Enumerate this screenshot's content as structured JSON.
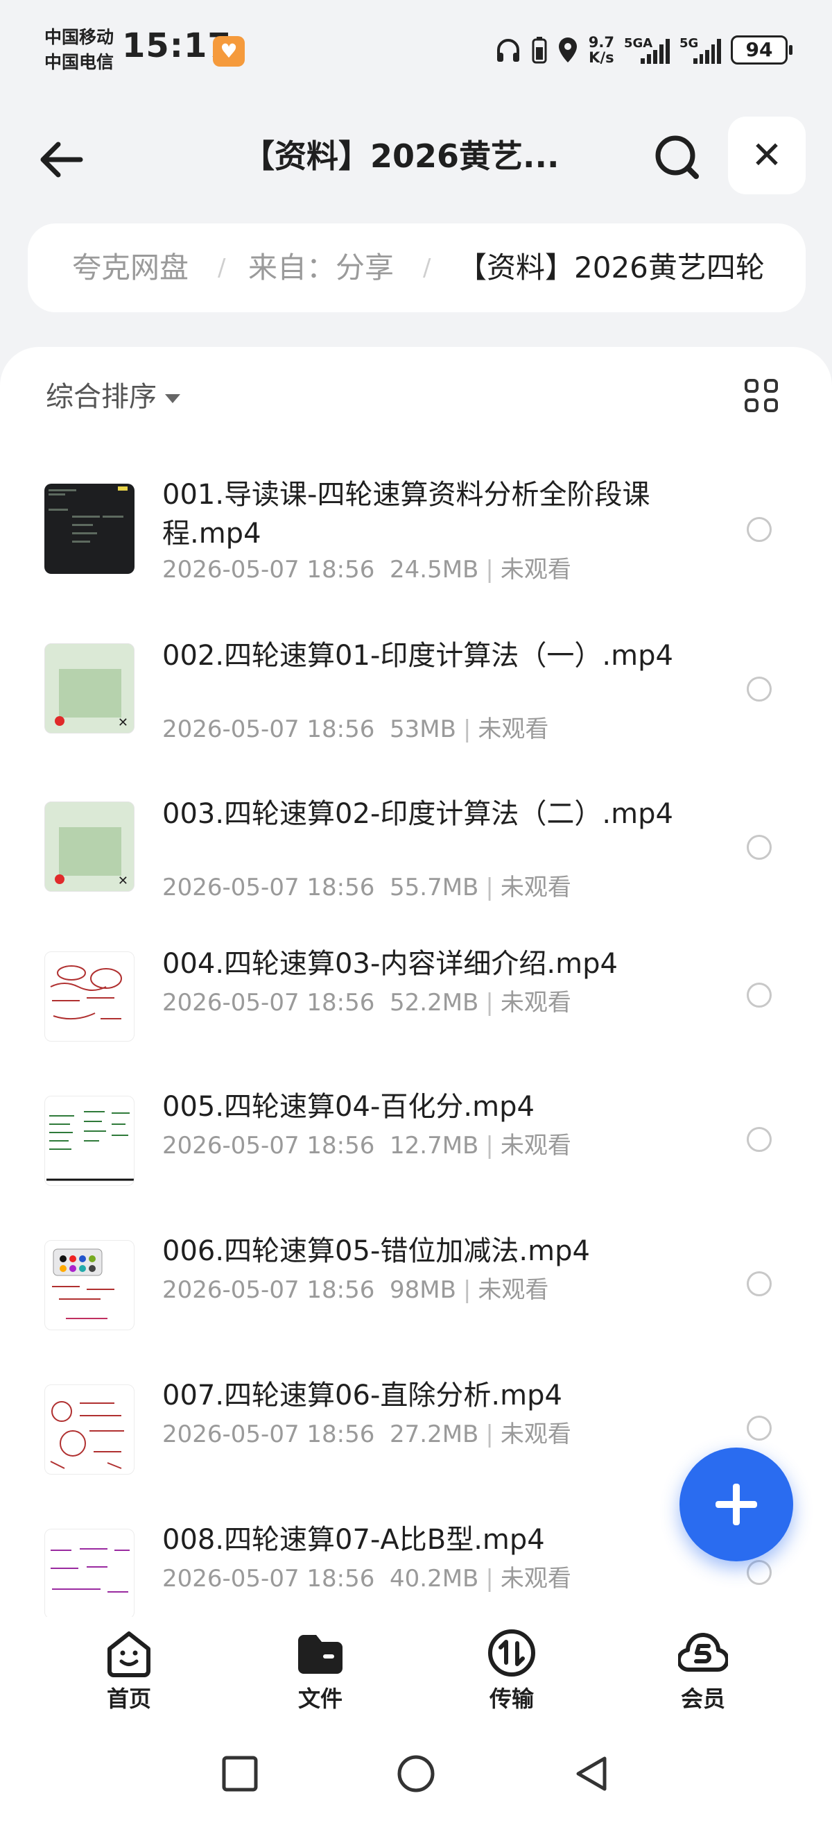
{
  "status_bar": {
    "carrier_1": "中国移动",
    "carrier_2": "中国电信",
    "time": "15:17",
    "net_speed_value": "9.7",
    "net_speed_unit": "K/s",
    "signal_1_label": "5GA",
    "signal_2_label": "5G",
    "battery": "94"
  },
  "header": {
    "title": "【资料】2026黄艺...",
    "back_icon": "arrow-left-icon",
    "search_icon": "search-icon",
    "close_label": "✕"
  },
  "breadcrumb": {
    "items": [
      "夸克网盘",
      "来自：分享",
      "【资料】2026黄艺四轮"
    ],
    "separator": "/"
  },
  "toolbar": {
    "sort_label": "综合排序",
    "view_icon": "grid-view-icon"
  },
  "files": [
    {
      "name": "001.导读课-四轮速算资料分析全阶段课程.mp4",
      "date": "2026-05-07 18:56",
      "size": "24.5MB",
      "status": "未观看"
    },
    {
      "name": "002.四轮速算01-印度计算法（一）.mp4",
      "date": "2026-05-07 18:56",
      "size": "53MB",
      "status": "未观看"
    },
    {
      "name": "003.四轮速算02-印度计算法（二）.mp4",
      "date": "2026-05-07 18:56",
      "size": "55.7MB",
      "status": "未观看"
    },
    {
      "name": "004.四轮速算03-内容详细介绍.mp4",
      "date": "2026-05-07 18:56",
      "size": "52.2MB",
      "status": "未观看"
    },
    {
      "name": "005.四轮速算04-百化分.mp4",
      "date": "2026-05-07 18:56",
      "size": "12.7MB",
      "status": "未观看"
    },
    {
      "name": "006.四轮速算05-错位加减法.mp4",
      "date": "2026-05-07 18:56",
      "size": "98MB",
      "status": "未观看"
    },
    {
      "name": "007.四轮速算06-直除分析.mp4",
      "date": "2026-05-07 18:56",
      "size": "27.2MB",
      "status": "未观看"
    },
    {
      "name": "008.四轮速算07-A比B型.mp4",
      "date": "2026-05-07 18:56",
      "size": "40.2MB",
      "status": "未观看"
    }
  ],
  "fab_icon": "plus-icon",
  "tabbar": [
    {
      "label": "首页",
      "icon": "home-face-icon"
    },
    {
      "label": "文件",
      "icon": "folder-icon"
    },
    {
      "label": "传输",
      "icon": "transfer-icon"
    },
    {
      "label": "会员",
      "icon": "vip-cloud-icon"
    }
  ],
  "colors": {
    "accent": "#2a6cf0",
    "background": "#f2f3f5",
    "secondary_text": "#9a9a9a"
  }
}
